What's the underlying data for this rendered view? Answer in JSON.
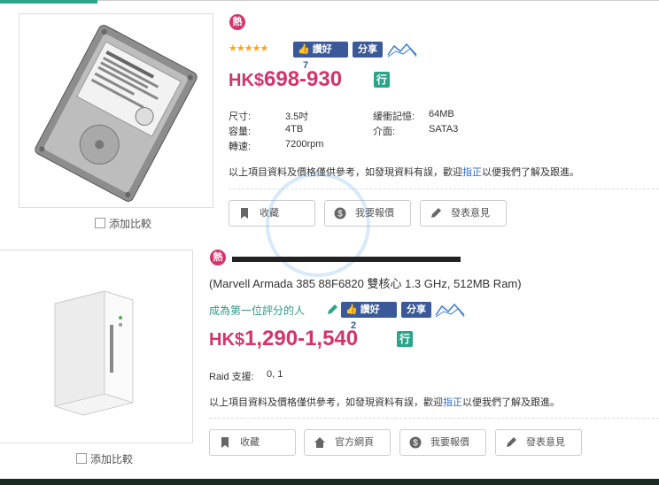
{
  "products": [
    {
      "hot_label": "熱",
      "stars": "★★★★★",
      "like": {
        "label": "讚好",
        "count": "7"
      },
      "share_label": "分享",
      "price": {
        "currency": "HK$",
        "range": "698-930"
      },
      "store_badge": "行",
      "specs": {
        "size_label": "尺寸:",
        "size_value": "3.5吋",
        "cache_label": "緩衝記憶:",
        "cache_value": "64MB",
        "capacity_label": "容量:",
        "capacity_value": "4TB",
        "interface_label": "介面:",
        "interface_value": "SATA3",
        "rpm_label": "轉速:",
        "rpm_value": "7200rpm"
      },
      "note_prefix": "以上項目資料及價格僅供參考，如發現資料有誤，歡迎",
      "note_link": "指正",
      "note_suffix": "以便我們了解及跟進。",
      "buttons": {
        "bookmark": "收藏",
        "report_price": "我要報價",
        "feedback": "發表意見"
      },
      "compare_label": "添加比較"
    },
    {
      "hot_label": "熱",
      "subtitle": "(Marvell Armada 385 88F6820 雙核心 1.3 GHz, 512MB Ram)",
      "rate_link": "成為第一位評分的人",
      "like": {
        "label": "讚好",
        "count": "2"
      },
      "share_label": "分享",
      "price": {
        "currency": "HK$",
        "range": "1,290-1,540"
      },
      "store_badge": "行",
      "specs": {
        "raid_label": "Raid 支援:",
        "raid_value": "0, 1"
      },
      "note_prefix": "以上項目資料及價格僅供參考，如發現資料有誤，歡迎",
      "note_link": "指正",
      "note_suffix": "以便我們了解及跟進。",
      "buttons": {
        "bookmark": "收藏",
        "official_site": "官方網頁",
        "report_price": "我要報價",
        "feedback": "發表意見"
      },
      "compare_label": "添加比較"
    }
  ],
  "colors": {
    "accent": "#2aa58a",
    "price": "#d6336c",
    "facebook": "#3b5998",
    "link": "#2a6ad6"
  }
}
